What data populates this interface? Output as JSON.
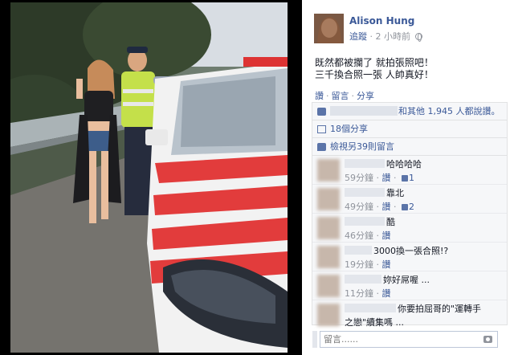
{
  "post": {
    "author": "Alison Hung",
    "follow_label": "追蹤",
    "time": "2 小時前",
    "text_line1": "既然都被攔了 就拍張照吧！",
    "text_line2": "三千換合照一張 人帥真好！",
    "actions": {
      "like": "讚",
      "comment": "留言",
      "share": "分享"
    }
  },
  "ufi": {
    "likes_text": "和其他 1,945 人都說讚。",
    "shares_text": "18個分享",
    "view_comments": "檢視另39則留言"
  },
  "comments": [
    {
      "text": "哈哈哈哈",
      "time": "59分鐘",
      "like": "讚",
      "likes": "1"
    },
    {
      "text": "靠北",
      "time": "49分鐘",
      "like": "讚",
      "likes": "2"
    },
    {
      "text": "酷",
      "time": "46分鐘",
      "like": "讚",
      "likes": ""
    },
    {
      "text": "3000換一張合照!?",
      "time": "19分鐘",
      "like": "讚",
      "likes": ""
    },
    {
      "text": "妳好屌喔 ...",
      "time": "11分鐘",
      "like": "讚",
      "likes": ""
    },
    {
      "text": "你要拍屈哥的\"運轉手",
      "text2": "之戀\"續集嗎 ...",
      "time": "",
      "like": "",
      "likes": ""
    }
  ],
  "composer": {
    "placeholder": "留言......"
  },
  "colors": {
    "link": "#3b5998",
    "muted": "#90949c",
    "panel_bg": "#f6f7f9",
    "backdrop": "#000000"
  },
  "icons": [
    "globe-icon",
    "like-icon",
    "share-icon",
    "comments-icon",
    "camera-icon"
  ]
}
